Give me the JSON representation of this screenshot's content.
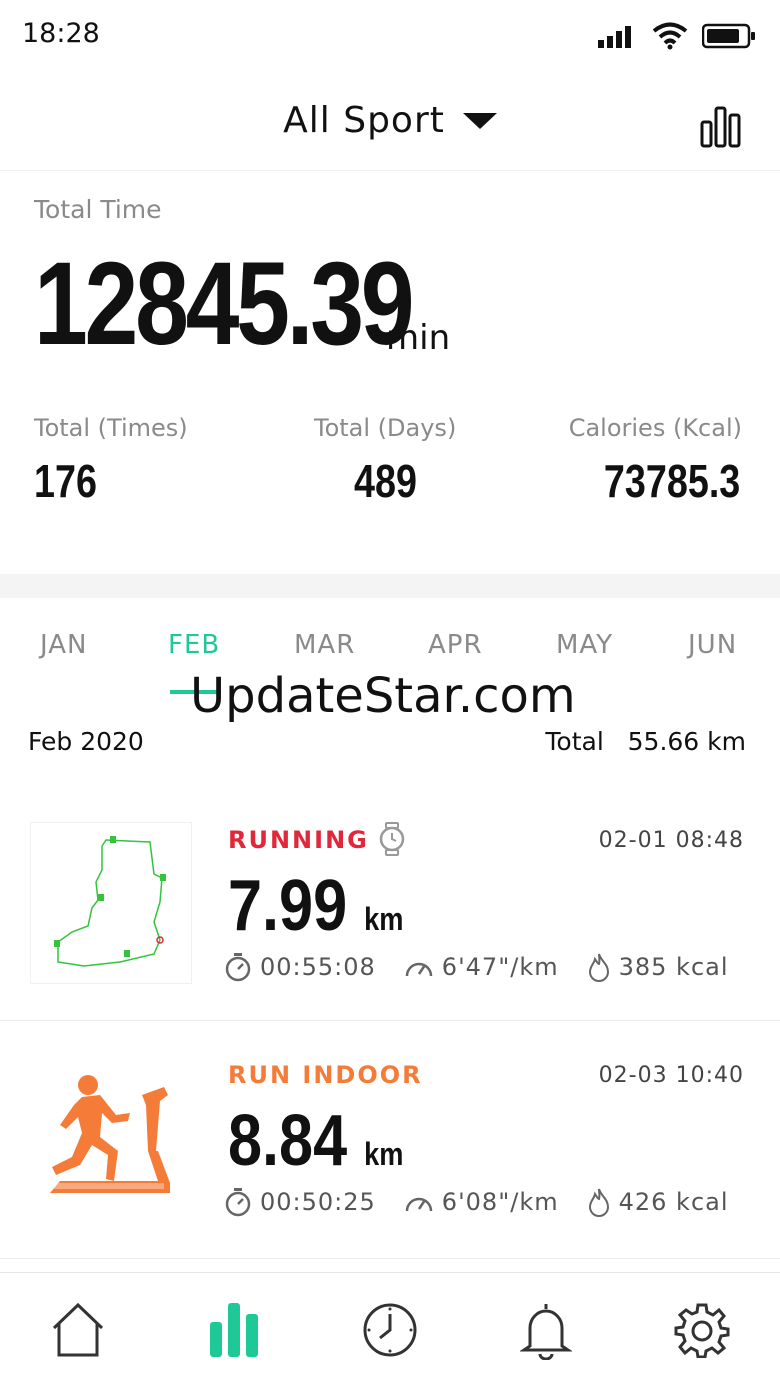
{
  "status_bar": {
    "time": "18:28"
  },
  "header": {
    "title": "All Sport"
  },
  "summary": {
    "total_time_label": "Total Time",
    "total_time_value": "12845.39",
    "total_time_unit": "min",
    "stats": [
      {
        "label": "Total (Times)",
        "value": "176"
      },
      {
        "label": "Total (Days)",
        "value": "489"
      },
      {
        "label": "Calories (Kcal)",
        "value": "73785.3"
      }
    ]
  },
  "months": [
    "JAN",
    "FEB",
    "MAR",
    "APR",
    "MAY",
    "JUN"
  ],
  "selected_month": "FEB",
  "watermark": "UpdateStar.com",
  "period": {
    "label": "Feb 2020",
    "total_prefix": "Total",
    "total_value": "55.66 km"
  },
  "activities": [
    {
      "type": "RUNNING",
      "type_color": "#e0283a",
      "date": "02-01  08:48",
      "distance": "7.99",
      "unit": "km",
      "duration": "00:55:08",
      "pace": "6'47\"/km",
      "calories": "385 kcal"
    },
    {
      "type": "RUN INDOOR",
      "type_color": "#f47c38",
      "date": "02-03  10:40",
      "distance": "8.84",
      "unit": "km",
      "duration": "00:50:25",
      "pace": "6'08\"/km",
      "calories": "426 kcal"
    }
  ],
  "colors": {
    "accent": "#1fc997",
    "running": "#e0283a",
    "indoor": "#f47c38",
    "map_route": "#34c43b"
  },
  "nav_icons": [
    "home-icon",
    "stats-icon",
    "clock-icon",
    "bell-icon",
    "gear-icon"
  ]
}
